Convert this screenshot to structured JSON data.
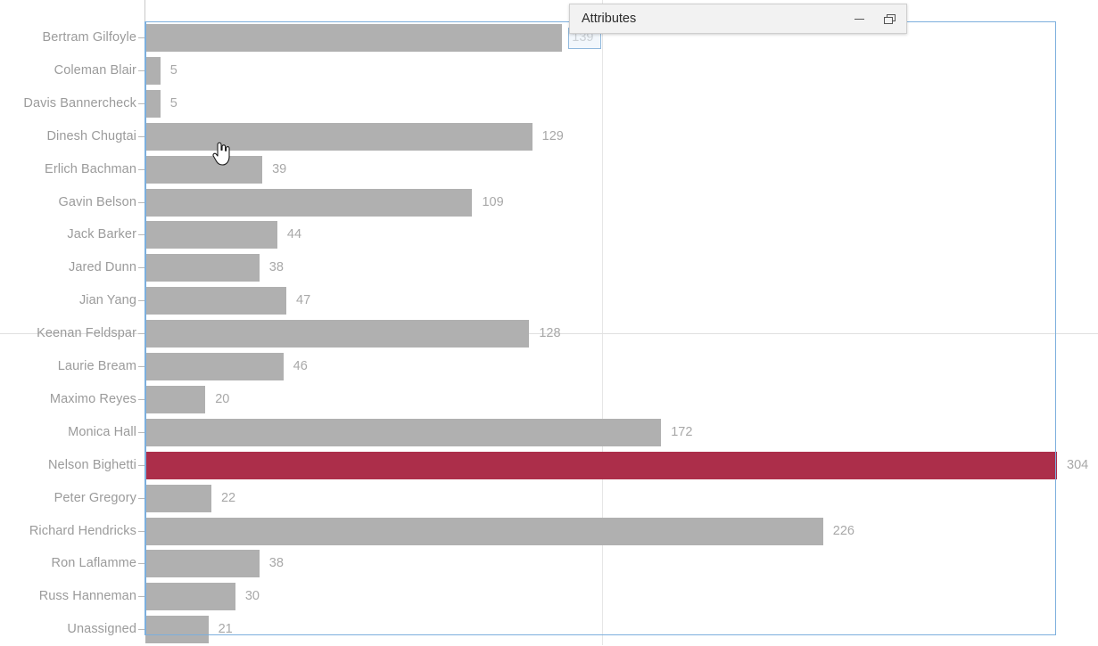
{
  "window": {
    "title": "Attributes",
    "minimize_label": "Minimize",
    "restore_label": "Restore",
    "minimize_icon": "minimize-icon",
    "restore_icon": "restore-window-icon"
  },
  "cursor": {
    "icon": "pointing-hand-cursor"
  },
  "selection": {
    "highlighted_category": "Nelson Bighetti",
    "highlighted_color": "#ac2e4a"
  },
  "colors": {
    "bar": "#b0b0b0",
    "bar_highlight": "#ac2e4a",
    "label_text": "#9b9b9b",
    "value_text": "#a8a8a8",
    "plot_border": "#7cafdd",
    "gridline": "#e0e0e0"
  },
  "chart_data": {
    "type": "bar",
    "orientation": "horizontal",
    "title": "",
    "subtitle": "",
    "xlabel": "",
    "ylabel": "",
    "grid": true,
    "legend": null,
    "xlim": [
      0,
      304
    ],
    "categories": [
      "Bertram Gilfoyle",
      "Coleman Blair",
      "Davis Bannercheck",
      "Dinesh Chugtai",
      "Erlich Bachman",
      "Gavin Belson",
      "Jack Barker",
      "Jared Dunn",
      "Jian Yang",
      "Keenan Feldspar",
      "Laurie Bream",
      "Maximo Reyes",
      "Monica Hall",
      "Nelson Bighetti",
      "Peter Gregory",
      "Richard Hendricks",
      "Ron Laflamme",
      "Russ Hanneman",
      "Unassigned"
    ],
    "values": [
      139,
      5,
      5,
      129,
      39,
      109,
      44,
      38,
      47,
      128,
      46,
      20,
      172,
      304,
      22,
      226,
      38,
      30,
      21
    ],
    "value_labels": [
      "139",
      "5",
      "5",
      "129",
      "39",
      "109",
      "44",
      "38",
      "47",
      "128",
      "46",
      "20",
      "172",
      "304",
      "22",
      "226",
      "38",
      "30",
      "21"
    ],
    "highlighted_index": 13
  }
}
